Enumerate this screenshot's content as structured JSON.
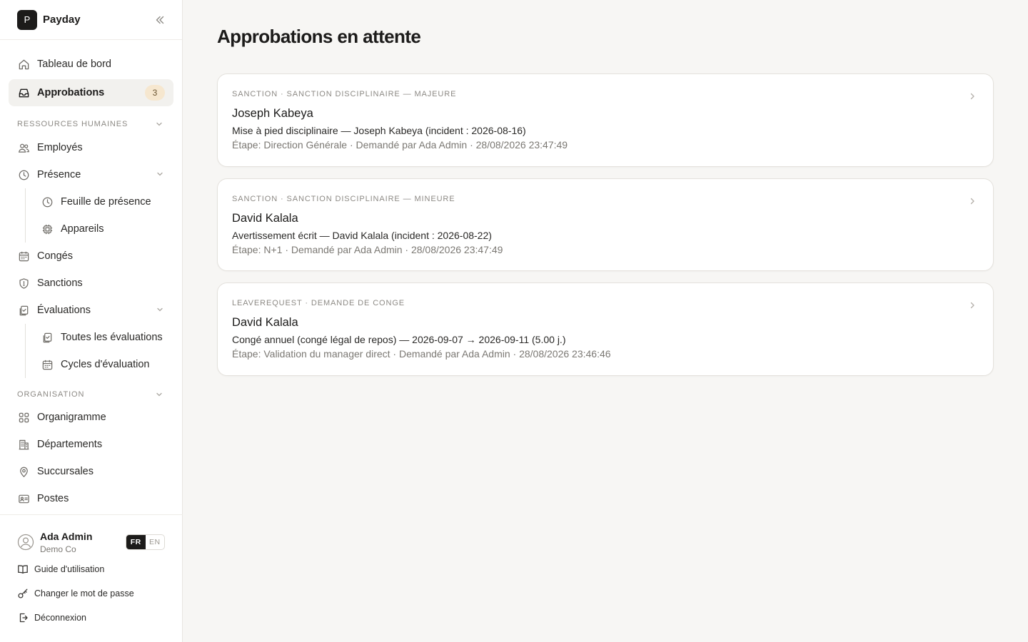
{
  "app": {
    "logo_letter": "P",
    "name": "Payday"
  },
  "nav": {
    "dashboard": "Tableau de bord",
    "approvals": "Approbations",
    "approvals_badge": "3",
    "hr_section": "RESSOURCES HUMAINES",
    "employees": "Employés",
    "presence": "Présence",
    "timesheet": "Feuille de présence",
    "devices": "Appareils",
    "leaves": "Congés",
    "sanctions": "Sanctions",
    "evaluations": "Évaluations",
    "all_evaluations": "Toutes les évaluations",
    "evaluation_cycles": "Cycles d'évaluation",
    "org_section": "ORGANISATION",
    "orgchart": "Organigramme",
    "departments": "Départements",
    "branches": "Succursales",
    "positions": "Postes"
  },
  "user": {
    "name": "Ada Admin",
    "org": "Demo Co",
    "lang_fr": "FR",
    "lang_en": "EN",
    "active_lang": "FR"
  },
  "footer": {
    "guide": "Guide d'utilisation",
    "change_password": "Changer le mot de passe",
    "logout": "Déconnexion"
  },
  "page": {
    "title": "Approbations en attente"
  },
  "approvals": [
    {
      "kicker": "SANCTION · SANCTION DISCIPLINAIRE — MAJEURE",
      "name": "Joseph Kabeya",
      "description": "Mise à pied disciplinaire — Joseph Kabeya (incident : 2026-08-16)",
      "meta": "Étape: Direction Générale · Demandé par Ada Admin · 28/08/2026 23:47:49"
    },
    {
      "kicker": "SANCTION · SANCTION DISCIPLINAIRE — MINEURE",
      "name": "David Kalala",
      "description": "Avertissement écrit — David Kalala (incident : 2026-08-22)",
      "meta": "Étape: N+1 · Demandé par Ada Admin · 28/08/2026 23:47:49"
    },
    {
      "kicker": "LEAVEREQUEST · DEMANDE DE CONGE",
      "name": "David Kalala",
      "description": "Congé annuel (congé légal de repos) — 2026-09-07 → 2026-09-11 (5.00 j.)",
      "meta": "Étape: Validation du manager direct · Demandé par Ada Admin · 28/08/2026 23:46:46"
    }
  ],
  "colors": {
    "accent_badge_bg": "#f6e7cf",
    "active_nav_bg": "#f2f1ee",
    "text_primary": "#1c1b1a",
    "text_muted": "#7b7873"
  }
}
